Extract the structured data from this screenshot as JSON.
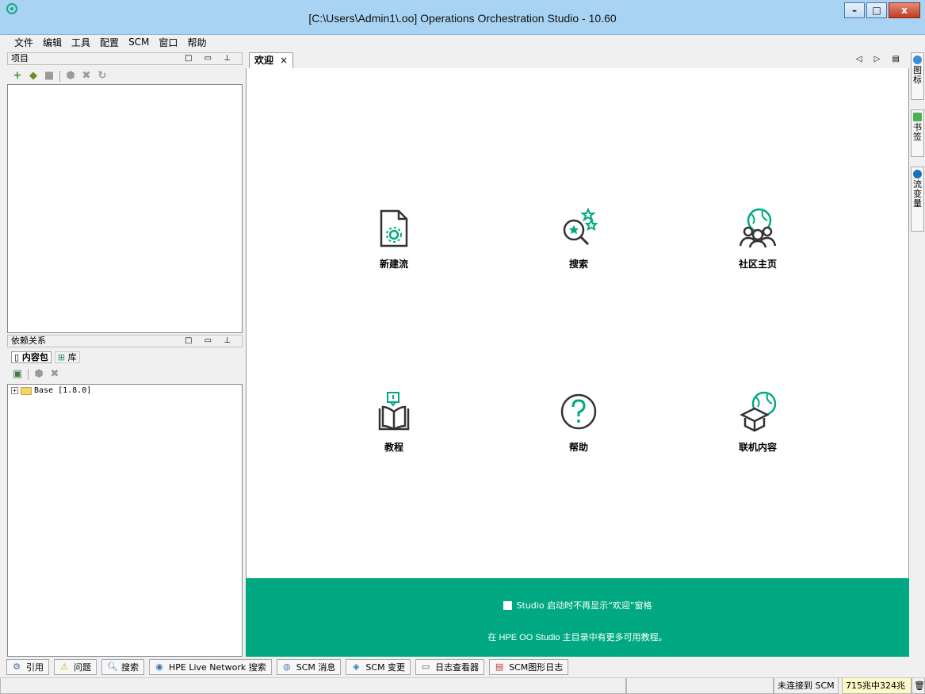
{
  "window": {
    "title": "[C:\\Users\\Admin1\\.oo] Operations Orchestration Studio - 10.60",
    "minimize": "–",
    "maximize": "□",
    "close": "x"
  },
  "menu": [
    "文件",
    "编辑",
    "工具",
    "配置",
    "SCM",
    "窗口",
    "帮助"
  ],
  "projects_panel": {
    "title": "项目",
    "controls": "□ ▭ ⊥"
  },
  "dependencies_panel": {
    "title": "依赖关系",
    "controls": "□ ▭ ⊥",
    "tabs": [
      "内容包",
      "库"
    ],
    "tree": [
      {
        "label": "Base [1.8.0]"
      }
    ]
  },
  "editor": {
    "tab_label": "欢迎",
    "tab_close": "×",
    "nav": "◁ ▷ ▤"
  },
  "welcome": {
    "tiles": [
      {
        "label": "新建流",
        "icon": "new-flow-icon"
      },
      {
        "label": "搜索",
        "icon": "search-star-icon"
      },
      {
        "label": "社区主页",
        "icon": "community-icon"
      },
      {
        "label": "教程",
        "icon": "tutorial-book-icon"
      },
      {
        "label": "帮助",
        "icon": "help-question-icon"
      },
      {
        "label": "联机内容",
        "icon": "online-content-box-icon"
      }
    ],
    "checkbox_label": "Studio 启动时不再显示“欢迎”窗格",
    "hint": "在 HPE OO Studio 主目录中有更多可用教程。",
    "brand_color": "#01a982"
  },
  "right_rail": [
    "图标",
    "书签",
    "流变量"
  ],
  "bottom_tabs": [
    "引用",
    "问题",
    "搜索",
    "HPE Live Network 搜索",
    "SCM 消息",
    "SCM 变更",
    "日志查看器",
    "SCM图形日志"
  ],
  "status": {
    "scm": "未连接到 SCM",
    "memory": "715兆中324兆"
  }
}
